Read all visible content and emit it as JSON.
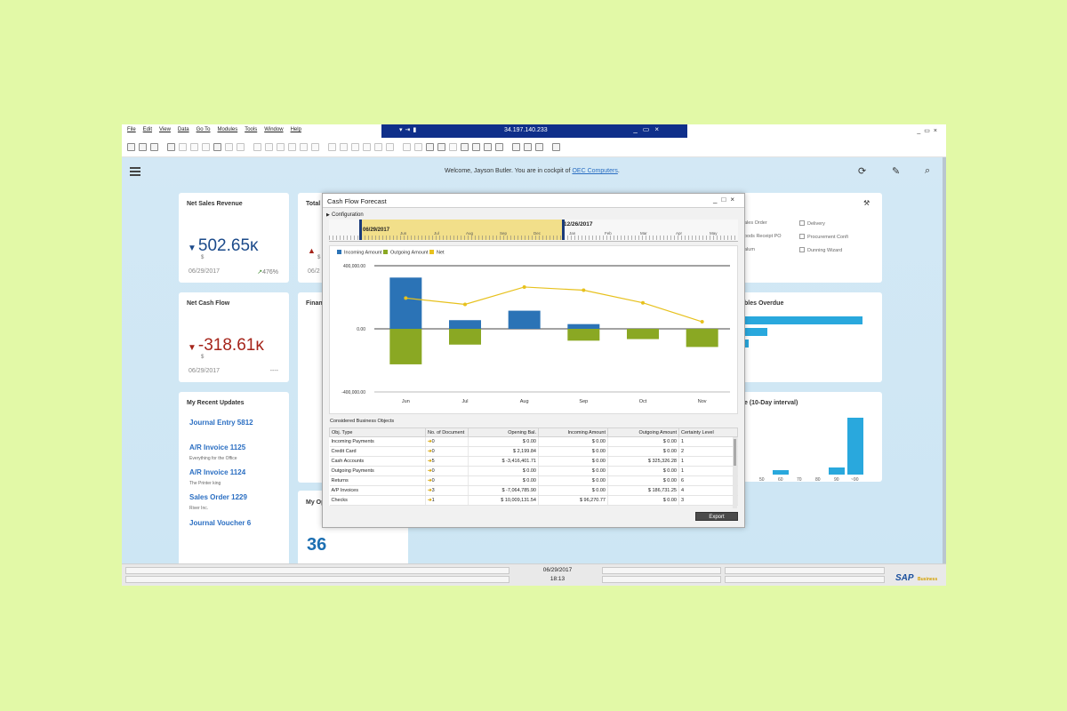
{
  "menu": {
    "items": [
      "File",
      "Edit",
      "View",
      "Data",
      "Go To",
      "Modules",
      "Tools",
      "Window",
      "Help"
    ]
  },
  "remote_session": {
    "host": "34.197.140.233"
  },
  "window_controls": {
    "minimize": "_",
    "restore": "▭",
    "close": "×"
  },
  "header": {
    "welcome_prefix": "Welcome, Jayson Butler.  You are in cockpit of",
    "company": "OEC Computers",
    "suffix": "."
  },
  "tiles": {
    "net_sales": {
      "title": "Net Sales Revenue",
      "value": "502.65ĸ",
      "unit": "$",
      "date": "06/29/2017",
      "trend": "476%"
    },
    "total": {
      "title": "Total",
      "unit": "$",
      "date": "06/2"
    },
    "net_cash_flow": {
      "title": "Net Cash Flow",
      "value": "-318.61ĸ",
      "unit": "$",
      "date": "06/29/2017",
      "trend": "----"
    },
    "finance": {
      "title": "Finan"
    },
    "my_open": {
      "title": "My Op",
      "value": "36"
    },
    "recent_updates": {
      "title": "My Recent Updates",
      "items": [
        {
          "label": "Journal Entry 5812",
          "sub": ""
        },
        {
          "label": "A/R Invoice 1125",
          "sub": "Everything for the Office"
        },
        {
          "label": "A/R Invoice 1124",
          "sub": "The Printer king"
        },
        {
          "label": "Sales Order 1229",
          "sub": "River Inc."
        },
        {
          "label": "Journal Voucher 6",
          "sub": ""
        }
      ]
    },
    "shortcuts": {
      "items": [
        "ales Order",
        "Delivery",
        "oods Receipt PO",
        "Procurement Confi",
        "alum",
        "Dunning Wizard"
      ]
    },
    "overdue": {
      "title": "bles Overdue"
    },
    "interval": {
      "title": "e (10-Day interval)",
      "ticks": [
        "50",
        "60",
        "70",
        "80",
        "90",
        "~90"
      ]
    }
  },
  "dialog": {
    "title": "Cash Flow Forecast",
    "configuration_label": "Configuration",
    "timeline": {
      "start": "06/29/2017",
      "end": "12/26/2017",
      "months": [
        "Jun",
        "Jul",
        "Aug",
        "Sep",
        "Oct",
        "Dec",
        "Jan",
        "Feb",
        "Mar",
        "Apr",
        "May"
      ]
    },
    "objects_title": "Considered Business Objects",
    "export_label": "Export"
  },
  "chart_data": {
    "type": "bar",
    "categories": [
      "Jun",
      "Jul",
      "Aug",
      "Sep",
      "Oct",
      "Nov"
    ],
    "series": [
      {
        "name": "Incoming Amount",
        "color": "#2b73b6",
        "values": [
          325000,
          55000,
          115000,
          30000,
          0,
          0
        ]
      },
      {
        "name": "Outgoing Amount",
        "color": "#8aa823",
        "values": [
          -225000,
          -100000,
          0,
          -75000,
          -65000,
          -115000
        ]
      },
      {
        "name": "Net",
        "color": "#e7c11d",
        "values": [
          195000,
          155000,
          265000,
          245000,
          165000,
          45000
        ],
        "style": "line"
      }
    ],
    "ylim": [
      -400000,
      400000
    ],
    "yticks": [
      "400,000.00",
      "0.00",
      "-400,000.00"
    ],
    "legend": "top-left"
  },
  "table": {
    "columns": [
      "Obj. Type",
      "No. of Document",
      "Opening Bal.",
      "Incoming Amount",
      "Outgoing Amount",
      "Certainty Level"
    ],
    "rows": [
      [
        "Incoming Payments",
        "0",
        "$ 0.00",
        "$ 0.00",
        "$ 0.00",
        "1"
      ],
      [
        "Credit Card",
        "0",
        "$ 2,199.84",
        "$ 0.00",
        "$ 0.00",
        "2"
      ],
      [
        "Cash Accounts",
        "5",
        "$ -3,416,401.71",
        "$ 0.00",
        "$ 325,326.28",
        "1"
      ],
      [
        "Outgoing Payments",
        "0",
        "$ 0.00",
        "$ 0.00",
        "$ 0.00",
        "1"
      ],
      [
        "Returns",
        "0",
        "$ 0.00",
        "$ 0.00",
        "$ 0.00",
        "6"
      ],
      [
        "A/P Invoices",
        "3",
        "$ -7,064,785.90",
        "$ 0.00",
        "$ 186,731.25",
        "4"
      ],
      [
        "Checks",
        "1",
        "$ 10,009,131.54",
        "$ 96,270.77",
        "$ 0.00",
        "3"
      ]
    ]
  },
  "status_bar": {
    "date": "06/29/2017",
    "time": "18:13"
  },
  "brand": {
    "sap": "SAP",
    "product": "Business One"
  }
}
